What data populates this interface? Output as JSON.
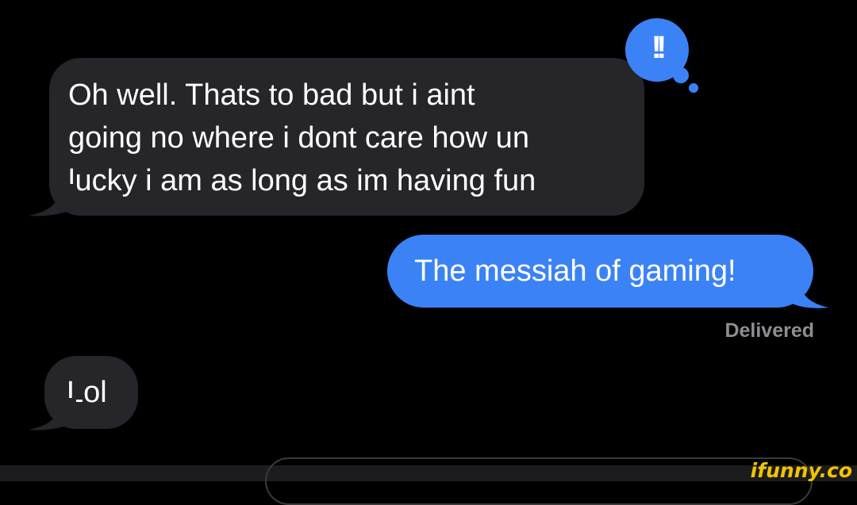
{
  "conversation": {
    "messages": [
      {
        "direction": "incoming",
        "text": "Oh well. Thats to bad but i aint\ngoing no where i dont care how un\nlucky i am as long as im having fun"
      },
      {
        "direction": "outgoing",
        "text": "The messiah of gaming!"
      },
      {
        "direction": "incoming",
        "text": "Lol"
      }
    ],
    "delivery_status": "Delivered",
    "reaction": {
      "text": "!!",
      "icon": "emphasis-reaction-icon"
    }
  },
  "watermark": "ifunny.co",
  "colors": {
    "background": "#000000",
    "incoming_bubble": "#26252a",
    "outgoing_bubble": "#3b82f6",
    "status_text": "#8e8e93",
    "watermark": "#f2c300"
  }
}
